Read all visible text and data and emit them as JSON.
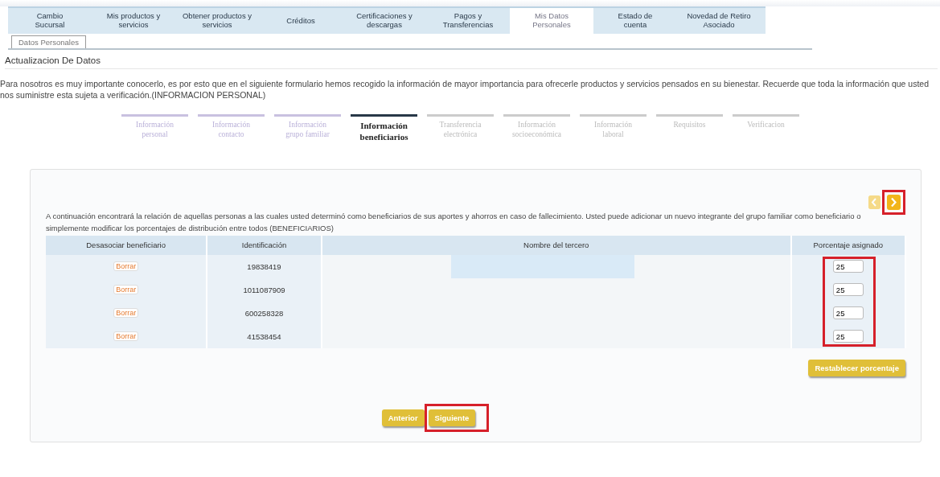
{
  "main_tabs": [
    {
      "label": "Cambio\nSucursal",
      "selected": false
    },
    {
      "label": "Mis productos y\nservicios",
      "selected": false
    },
    {
      "label": "Obtener productos y\nservicios",
      "selected": false
    },
    {
      "label": "Créditos",
      "selected": false
    },
    {
      "label": "Certificaciones y\ndescargas",
      "selected": false
    },
    {
      "label": "Pagos y\nTransferencias",
      "selected": false
    },
    {
      "label": "Mis Datos\nPersonales",
      "selected": true
    },
    {
      "label": "Estado de\ncuenta",
      "selected": false
    },
    {
      "label": "Novedad de Retiro\nAsociado",
      "selected": false
    }
  ],
  "sub_tabs": [
    {
      "label": "Datos Personales"
    }
  ],
  "page_title": "Actualizacion De Datos",
  "intro": "Para nosotros es muy importante conocerlo, es por esto que en el siguiente formulario hemos recogido la información de mayor importancia para ofrecerle productos y servicios pensados en su bienestar. Recuerde que toda la información que usted nos suministre esta sujeta a verificación.(INFORMACION PERSONAL)",
  "steps": [
    {
      "label": "Información\npersonal",
      "completed": true,
      "selected": false
    },
    {
      "label": "Información\ncontacto",
      "completed": true,
      "selected": false
    },
    {
      "label": "Información\ngrupo familiar",
      "completed": true,
      "selected": false
    },
    {
      "label": "Información\nbeneficiarios",
      "completed": false,
      "selected": true
    },
    {
      "label": "Transferencia\nelectrónica",
      "completed": false,
      "selected": false
    },
    {
      "label": "Información\nsocioeconómica",
      "completed": false,
      "selected": false
    },
    {
      "label": "Información\nlaboral",
      "completed": false,
      "selected": false
    },
    {
      "label": "Requisitos",
      "completed": false,
      "selected": false
    },
    {
      "label": "Verificacion",
      "completed": false,
      "selected": false
    }
  ],
  "card": {
    "description": "A continuación encontrará la relación de aquellas personas a las cuales usted determinó como beneficiarios de sus aportes y ahorros en caso de fallecimiento. Usted puede adicionar un nuevo integrante del grupo familiar como beneficiario o simplemente modificar los porcentajes de distribución entre todos (BENEFICIARIOS)",
    "table": {
      "columns": [
        "Desasociar beneficiario",
        "Identificación",
        "Nombre del tercero",
        "Porcentaje asignado"
      ],
      "rows": [
        {
          "action": "Borrar",
          "id": "19838419",
          "percent": "25"
        },
        {
          "action": "Borrar",
          "id": "1011087909",
          "percent": "25"
        },
        {
          "action": "Borrar",
          "id": "600258328",
          "percent": "25"
        },
        {
          "action": "Borrar",
          "id": "41538454",
          "percent": "25"
        }
      ]
    },
    "reset_button": "Restablecer porcentaje",
    "buttons": [
      {
        "label": "Anterior",
        "highlighted": false
      },
      {
        "label": "Siguiente",
        "highlighted": true
      }
    ]
  }
}
